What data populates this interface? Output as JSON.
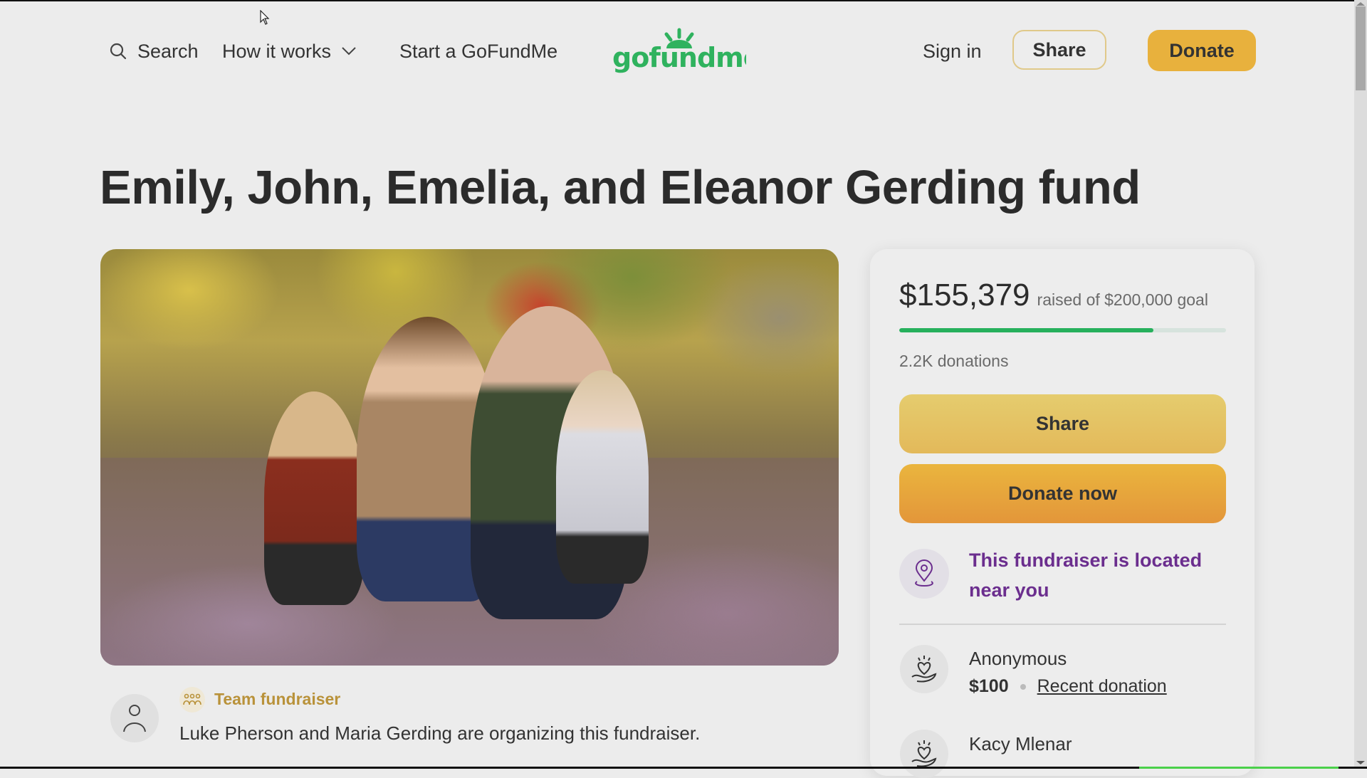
{
  "header": {
    "search_label": "Search",
    "how_it_works_label": "How it works",
    "start_label": "Start a GoFundMe",
    "logo_text": "gofundme",
    "signin_label": "Sign in",
    "share_label": "Share",
    "donate_label": "Donate"
  },
  "page": {
    "title": "Emily, John, Emelia, and Eleanor Gerding fund"
  },
  "organizer": {
    "badge_label": "Team fundraiser",
    "text": "Luke Pherson and Maria Gerding are organizing this fundraiser."
  },
  "donation_card": {
    "raised_amount": "$155,379",
    "goal_text": "raised of $200,000 goal",
    "progress_fraction": 0.777,
    "donation_count": "2.2K donations",
    "share_label": "Share",
    "donate_now_label": "Donate now",
    "location_notice": "This fundraiser is located near you",
    "donations": [
      {
        "name": "Anonymous",
        "amount": "$100",
        "tag": "Recent donation"
      },
      {
        "name": "Kacy Mlenar"
      }
    ]
  },
  "colors": {
    "brand_green": "#26b05c",
    "accent_gold": "#e8b13d",
    "location_purple": "#6b2e8e"
  }
}
